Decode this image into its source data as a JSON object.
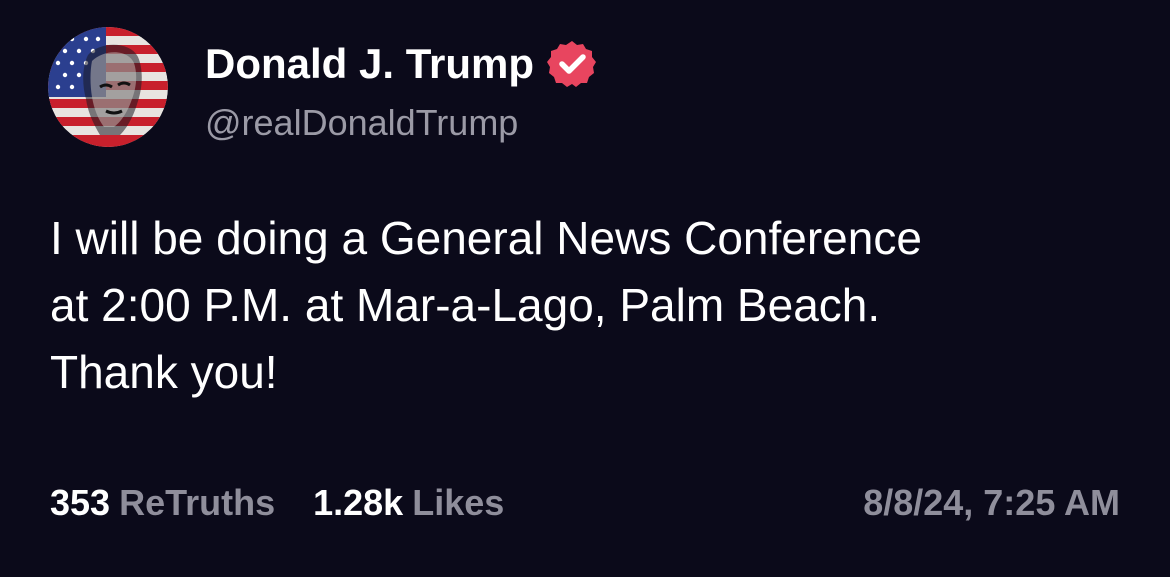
{
  "post": {
    "author": {
      "display_name": "Donald J. Trump",
      "handle": "@realDonaldTrump",
      "verified": true,
      "verified_icon": "verified-badge-icon",
      "verified_color": "#e8455f"
    },
    "body_lines": [
      "I will be doing a General News Conference",
      "at 2:00 P.M. at Mar-a-Lago, Palm Beach.",
      "Thank you!"
    ],
    "stats": {
      "retruths_count": "353",
      "retruths_label": "ReTruths",
      "likes_count": "1.28k",
      "likes_label": "Likes"
    },
    "timestamp": "8/8/24, 7:25 AM"
  },
  "colors": {
    "background": "#0b0a1a",
    "primary_text": "#ffffff",
    "secondary_text": "#9b9aa6"
  }
}
